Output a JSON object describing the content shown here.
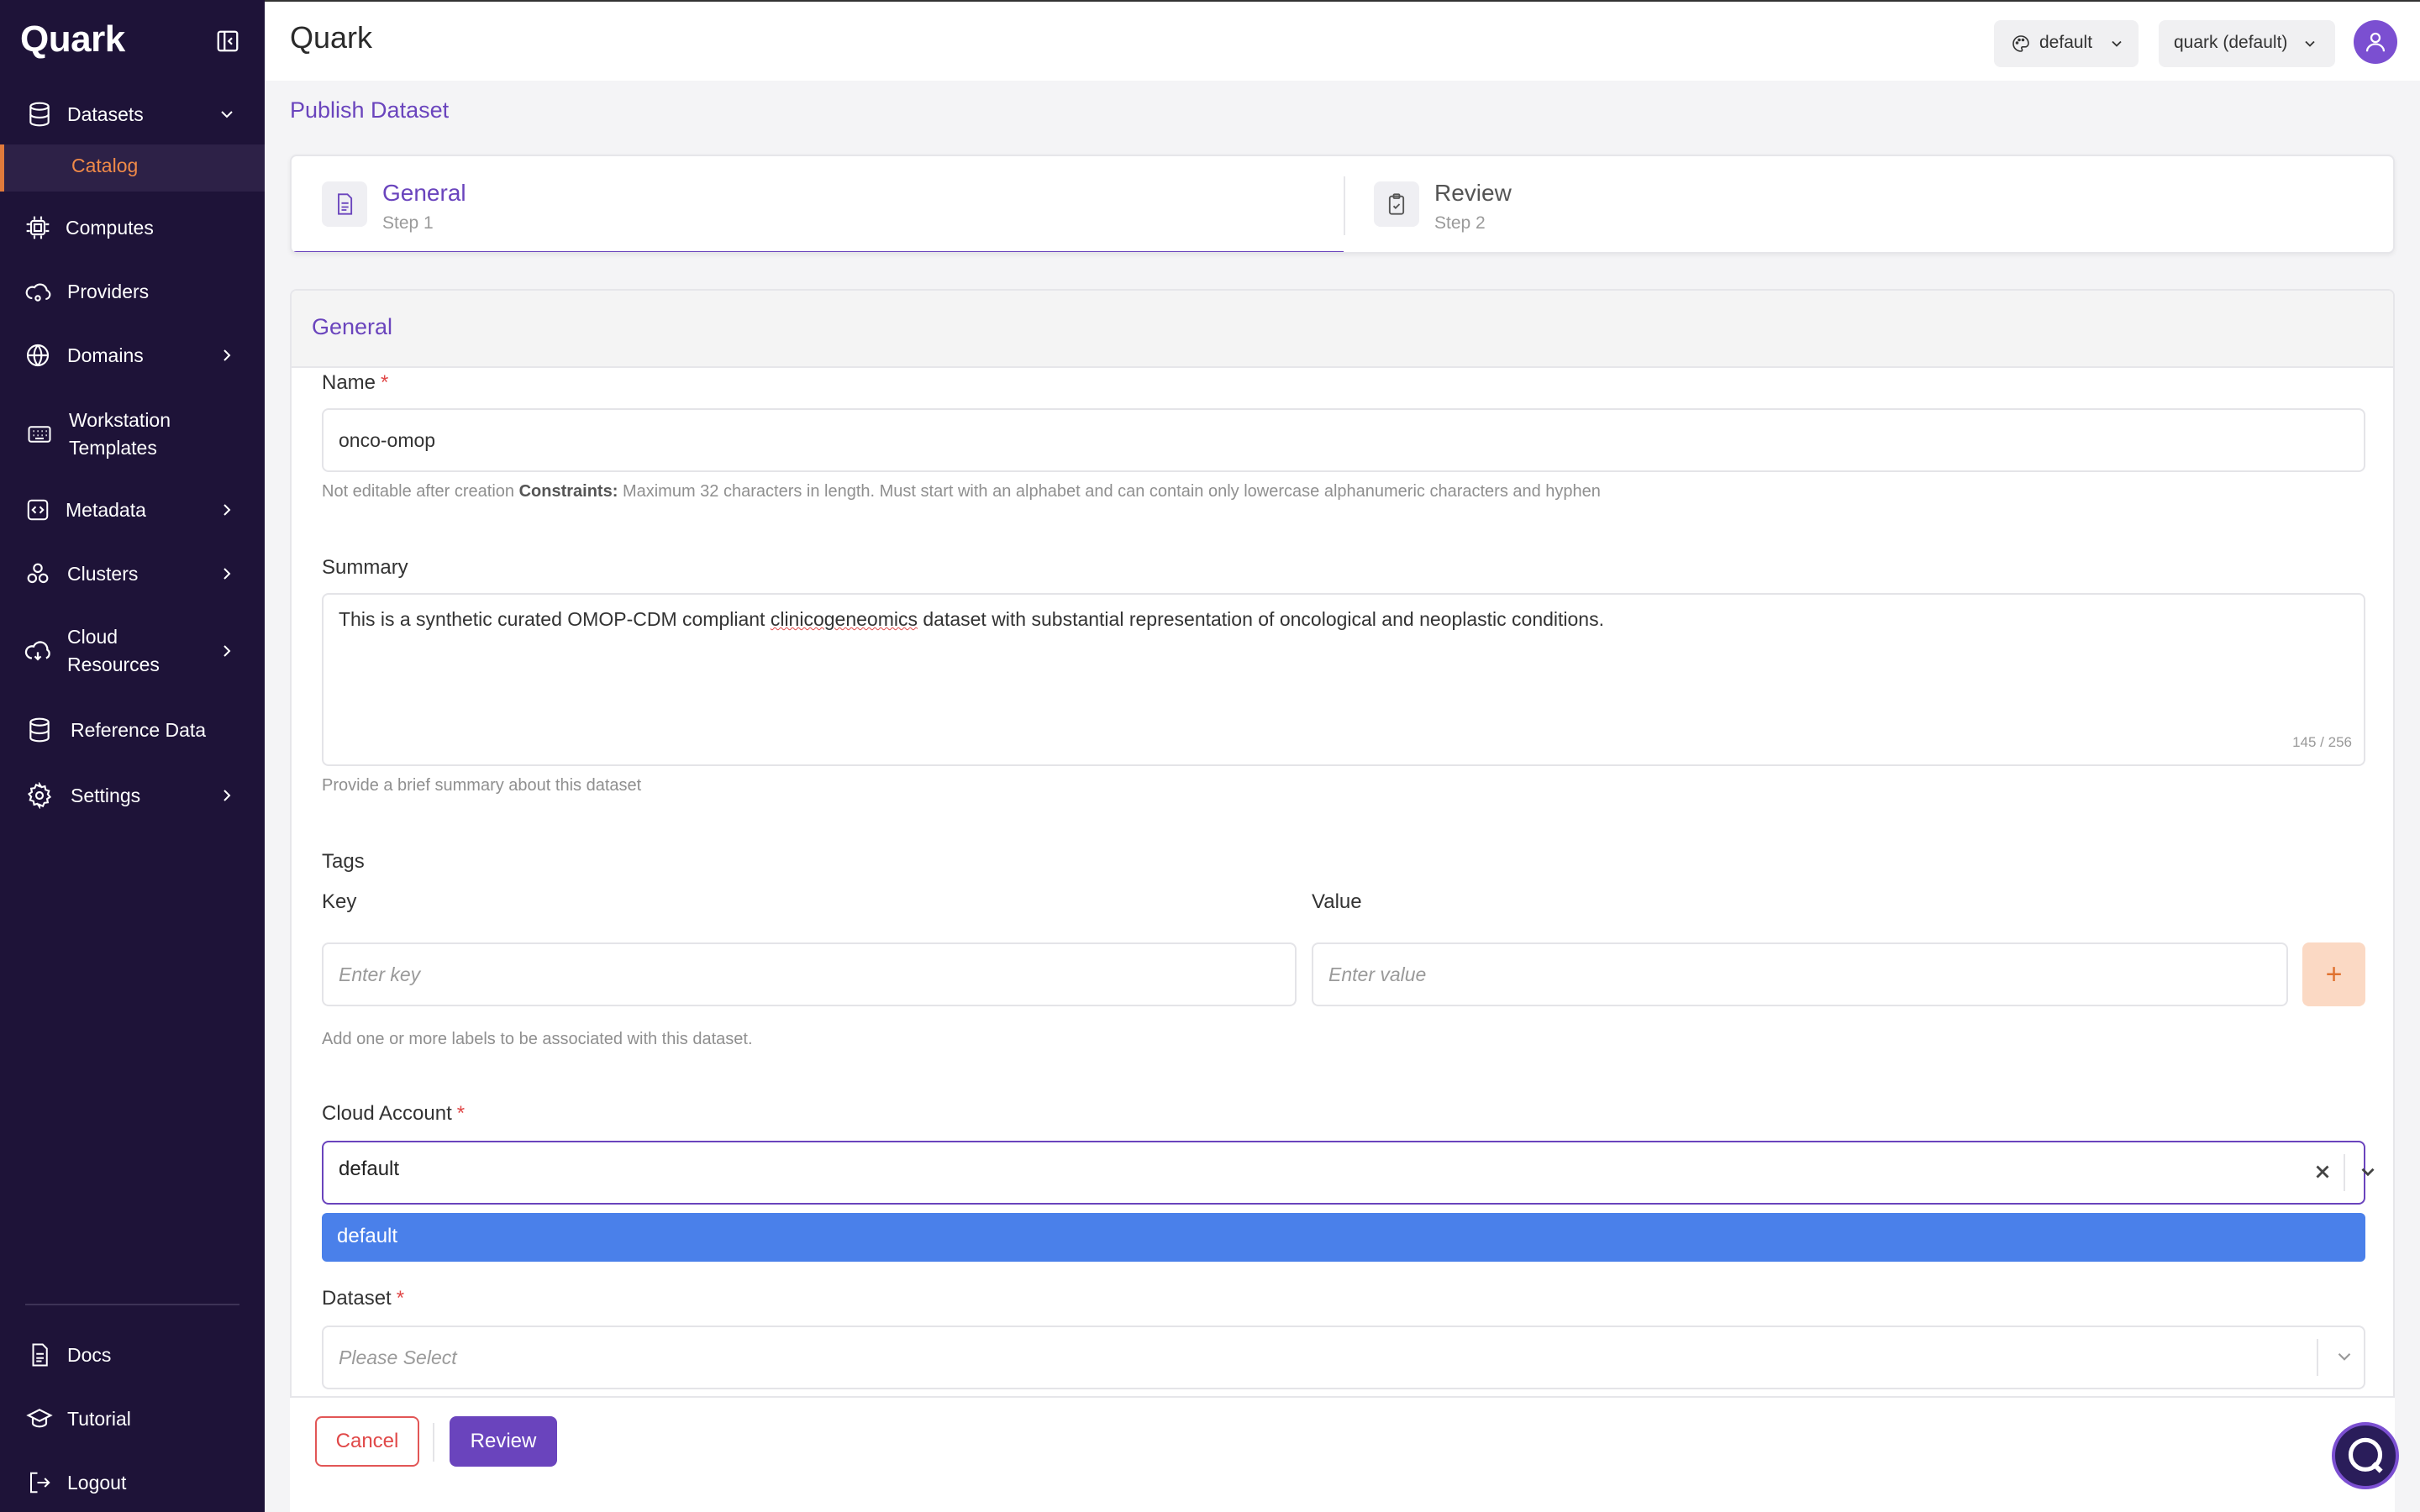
{
  "app": {
    "logo": "Quark",
    "title": "Quark"
  },
  "sidebar": {
    "items": [
      {
        "label": "Datasets",
        "icon": "database-icon"
      },
      {
        "label": "Catalog"
      },
      {
        "label": "Computes",
        "icon": "chip-icon"
      },
      {
        "label": "Providers",
        "icon": "providers-icon"
      },
      {
        "label": "Domains",
        "icon": "globe-icon"
      },
      {
        "label": "Workstation Templates",
        "icon": "keyboard-icon"
      },
      {
        "label": "Metadata",
        "icon": "code-icon"
      },
      {
        "label": "Clusters",
        "icon": "clusters-icon"
      },
      {
        "label": "Cloud Resources",
        "icon": "cloud-icon"
      },
      {
        "label": "Reference Data",
        "icon": "database-icon"
      },
      {
        "label": "Settings",
        "icon": "gear-icon"
      }
    ],
    "bottom": [
      {
        "label": "Docs",
        "icon": "doc-icon"
      },
      {
        "label": "Tutorial",
        "icon": "graduation-cap-icon"
      },
      {
        "label": "Logout",
        "icon": "logout-icon"
      }
    ]
  },
  "header": {
    "theme_select": "default",
    "workspace_select": "quark (default)"
  },
  "page": {
    "title": "Publish Dataset"
  },
  "stepper": [
    {
      "title": "General",
      "subtitle": "Step 1",
      "active": true
    },
    {
      "title": "Review",
      "subtitle": "Step 2",
      "active": false
    }
  ],
  "form": {
    "section_title": "General",
    "name": {
      "label": "Name",
      "value": "onco-omop",
      "help_prefix": "Not editable after creation",
      "help_constraints_label": "Constraints:",
      "help_constraints": "Maximum 32 characters in length. Must start with an alphabet and can contain only lowercase alphanumeric characters and hyphen"
    },
    "summary": {
      "label": "Summary",
      "value_before": "This is a synthetic curated OMOP-CDM compliant ",
      "value_misspelled": "clinicogeneomics",
      "value_after": " dataset with substantial representation of oncological and neoplastic conditions.",
      "counter": "145 / 256",
      "help": "Provide a brief summary about this dataset"
    },
    "tags": {
      "label": "Tags",
      "key_label": "Key",
      "value_label": "Value",
      "key_placeholder": "Enter key",
      "value_placeholder": "Enter value",
      "add_label": "+",
      "help": "Add one or more labels to be associated with this dataset."
    },
    "cloud_account": {
      "label": "Cloud Account",
      "value": "default",
      "options": [
        "default"
      ]
    },
    "dataset": {
      "label": "Dataset",
      "placeholder": "Please Select"
    }
  },
  "footer": {
    "cancel": "Cancel",
    "review": "Review"
  },
  "colors": {
    "brand": "#6a44bd",
    "sidebar": "#1e1338",
    "accent": "#e07a3c",
    "option_highlight": "#4a80ea"
  }
}
